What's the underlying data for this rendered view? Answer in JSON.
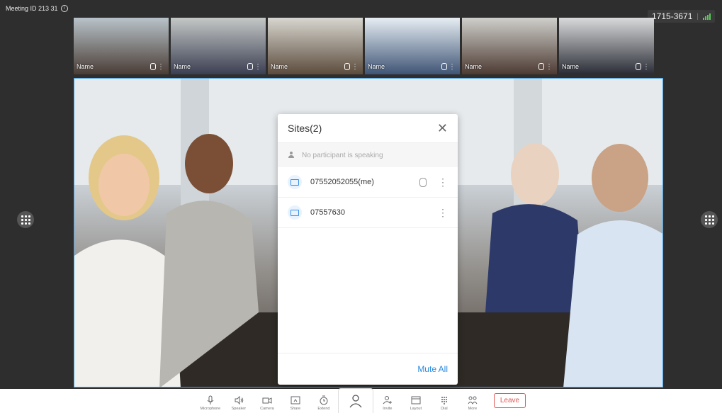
{
  "meeting": {
    "id_label": "Meeting ID 213 31",
    "code": "1715-3671",
    "separator": "|"
  },
  "thumbnails": [
    {
      "label": "Name",
      "color_top": "#b8c3c9",
      "color_bottom": "#4a3d36"
    },
    {
      "label": "Name",
      "color_top": "#c4c8c6",
      "color_bottom": "#3b3f52"
    },
    {
      "label": "Name",
      "color_top": "#d8d6d0",
      "color_bottom": "#5c4c3d"
    },
    {
      "label": "Name",
      "color_top": "#e7eef3",
      "color_bottom": "#3f5576"
    },
    {
      "label": "Name",
      "color_top": "#cfcfcb",
      "color_bottom": "#4d3b33"
    },
    {
      "label": "Name",
      "color_top": "#d9dadb",
      "color_bottom": "#2a2d36"
    }
  ],
  "sites_panel": {
    "title": "Sites(2)",
    "close_label": "✕",
    "speaking_status": "No participant is speaking",
    "participants": [
      {
        "name": "07552052055(me)",
        "has_mic": true,
        "more": "⋮"
      },
      {
        "name": "07557630",
        "has_mic": false,
        "more": "⋮"
      }
    ],
    "mute_all_label": "Mute All"
  },
  "toolbar": {
    "items": [
      {
        "label": "Microphone",
        "icon": "microphone-icon"
      },
      {
        "label": "Speaker",
        "icon": "speaker-icon"
      },
      {
        "label": "Camera",
        "icon": "camera-icon"
      },
      {
        "label": "Share",
        "icon": "share-icon"
      },
      {
        "label": "Extend",
        "icon": "timer-icon"
      }
    ],
    "active": {
      "icon": "participants-icon"
    },
    "items_right": [
      {
        "label": "Invite",
        "icon": "invite-icon"
      },
      {
        "label": "Layout",
        "icon": "layout-icon"
      },
      {
        "label": "Dial",
        "icon": "dialpad-icon"
      },
      {
        "label": "More",
        "icon": "more-icon"
      }
    ],
    "leave_label": "Leave"
  },
  "colors": {
    "accent": "#2a8ae2",
    "leave": "#e25555",
    "signal": "#5cc85c",
    "stage": "#2e2e2e"
  }
}
